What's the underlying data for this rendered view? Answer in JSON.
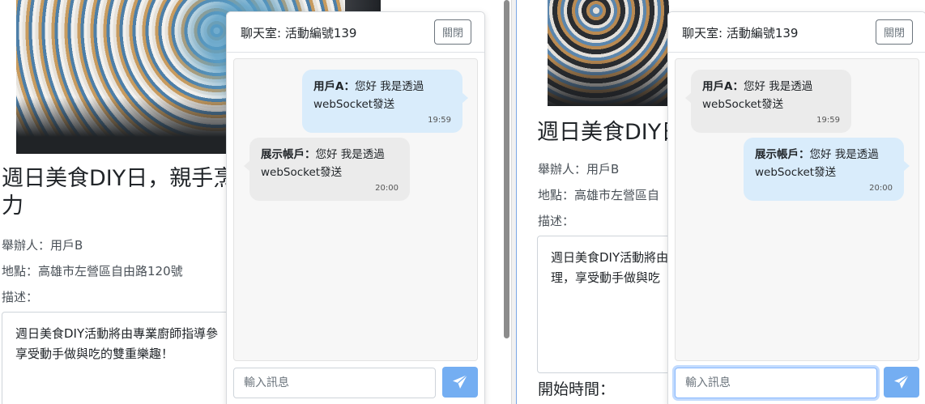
{
  "left_pane": {
    "event": {
      "title": "週日美食DIY日，親手烹力",
      "title_line1": "週日美食DIY日，親手烹",
      "title_line2": "力",
      "organizer": "舉辦人：用戶B",
      "location": "地點：高雄市左營區自由路120號",
      "description_label": "描述：",
      "description": "週日美食DIY活動將由專業廚師指導參享受動手做與吃的雙重樂趣！",
      "description_line1": "週日美食DIY活動將由專業廚師指導參",
      "description_line2": "享受動手做與吃的雙重樂趣！"
    },
    "chat": {
      "title": "聊天室: 活動編號139",
      "close_label": "關閉",
      "input_placeholder": "輸入訊息",
      "messages": [
        {
          "side": "mine",
          "sender": "用戶A：",
          "text": "您好 我是透過webSocket發送",
          "text_line1": "您好 我是透過",
          "text_line2": "webSocket發送",
          "time": "19:59"
        },
        {
          "side": "theirs",
          "sender": "展示帳戶：",
          "text": "您好 我是透過webSocket發送",
          "text_line1": "您好 我是透過",
          "text_line2": "webSocket發送",
          "time": "20:00"
        }
      ]
    }
  },
  "right_pane": {
    "event": {
      "title": "週日美食DIY日",
      "organizer": "舉辦人：用戶B",
      "location": "地點：高雄市左營區自",
      "description_label": "描述：",
      "description_line1": "週日美食DIY活動將由",
      "description_line2": "理，享受動手做與吃",
      "start_label": "開始時間："
    },
    "chat": {
      "title": "聊天室: 活動編號139",
      "close_label": "關閉",
      "input_placeholder": "輸入訊息",
      "messages": [
        {
          "side": "theirs",
          "sender": "用戶A：",
          "text_line1": "您好 我是透過",
          "text_line2": "webSocket發送",
          "time": "19:59"
        },
        {
          "side": "mine",
          "sender": "展示帳戶：",
          "text_line1": "您好 我是透過",
          "text_line2": "webSocket發送",
          "time": "20:00"
        }
      ]
    }
  },
  "colors": {
    "mine_bubble": "#d9ecfb",
    "theirs_bubble": "#ebebeb",
    "send_button": "#74aef2"
  },
  "icons": {
    "send": "paper-plane-icon"
  }
}
